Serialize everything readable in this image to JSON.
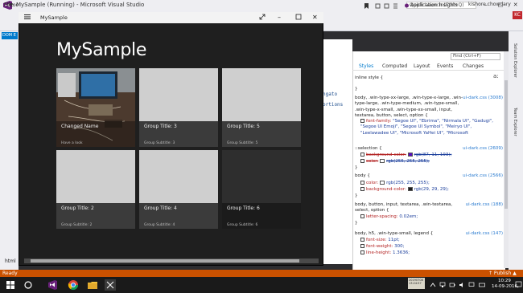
{
  "vs": {
    "title": "MySample (Running) - Microsoft Visual Studio",
    "quick_launch": "Quick Launch (Ctrl+Q)",
    "menu_file": "File",
    "user": "kishore chowdary",
    "avatar": "KC",
    "proc": "Proc",
    "app_insights": "Application Insights",
    "dom_tab": "DOM E",
    "html_tab": "html",
    "code_fragment_1": "ngato",
    "code_fragment_2": "ortions",
    "rail_label_1": "Solution Explorer",
    "rail_label_2": "Team Explorer"
  },
  "app": {
    "window_title": "MySample",
    "hub_title": "MySample",
    "tiles": [
      {
        "title": "Changed Name",
        "subtitle": "Have a look"
      },
      {
        "title": "Group Title: 3",
        "subtitle": "Group Subtitle: 3"
      },
      {
        "title": "Group Title: 5",
        "subtitle": "Group Subtitle: 5"
      },
      {
        "title": "Group Title: 2",
        "subtitle": "Group Subtitle: 2"
      },
      {
        "title": "Group Title: 4",
        "subtitle": "Group Subtitle: 4"
      },
      {
        "title": "Group Title: 6",
        "subtitle": "Group Subtitle: 6"
      }
    ]
  },
  "panel": {
    "find_placeholder": "Find (Ctrl+F)",
    "tabs": [
      "Styles",
      "Computed",
      "Layout",
      "Events",
      "Changes"
    ],
    "aa": "a:",
    "rules": {
      "inline": "inline style  {",
      "body_selector": "body, .win-type-xx-large, .win-type-x-large, .win-type-large, .win-type-medium, .win-type-small, .win-type-x-small, .win-type-xx-small, input, textarea, button, select, option  {",
      "body_src": "ui-dark.css (3008)",
      "font_family_name": "font-family:",
      "font_family_value": "\"Segoe UI\", \"Ebrima\", \"Nirmala UI\", \"Gadugi\", \"Segoe UI Emoji\", \"Segoe UI Symbol\", \"Meiryo UI\", \"Leelawadee UI\", \"Microsoft YaHei UI\", \"Microsoft",
      "selection_selector": "::selection  {",
      "selection_src": "ui-dark.css (2609)",
      "sel_bg_name": "background-color:",
      "sel_bg_value": "rgb(87, 11, 193);",
      "sel_color_name": "color:",
      "sel_color_value": "rgb(255, 255, 255);",
      "body2_selector": "body  {",
      "body2_src": "ui-dark.css (2566)",
      "body2_color_name": "color:",
      "body2_color_value": "rgb(255, 255, 255);",
      "body2_bg_name": "background-color:",
      "body2_bg_value": "rgb(29, 29, 29);",
      "body3_selector": "body, button, input, textarea, .win-textarea, select, option  {",
      "body3_src": "ui-dark.css (188)",
      "letter_name": "letter-spacing:",
      "letter_value": "0.02em;",
      "body4_selector": "body, h5, .win-type-small, legend  {",
      "body4_src": "ui-dark.css (147)",
      "fs_name": "font-size:",
      "fs_value": "11pt;",
      "fw_name": "font-weight:",
      "fw_value": "300;",
      "lh_name": "line-height:",
      "lh_value": "1.3636;",
      "close_brace": "}"
    }
  },
  "status": {
    "ready": "Ready",
    "publish": "↑  Publish  ▲"
  },
  "taskbar": {
    "time": "10:29",
    "date": "14-09-2016",
    "thumb_text": "20190708 13:24:57"
  },
  "colors": {
    "selection_swatch": "#570bc1",
    "white_swatch": "#ffffff",
    "bg_swatch": "#1d1d1d"
  }
}
